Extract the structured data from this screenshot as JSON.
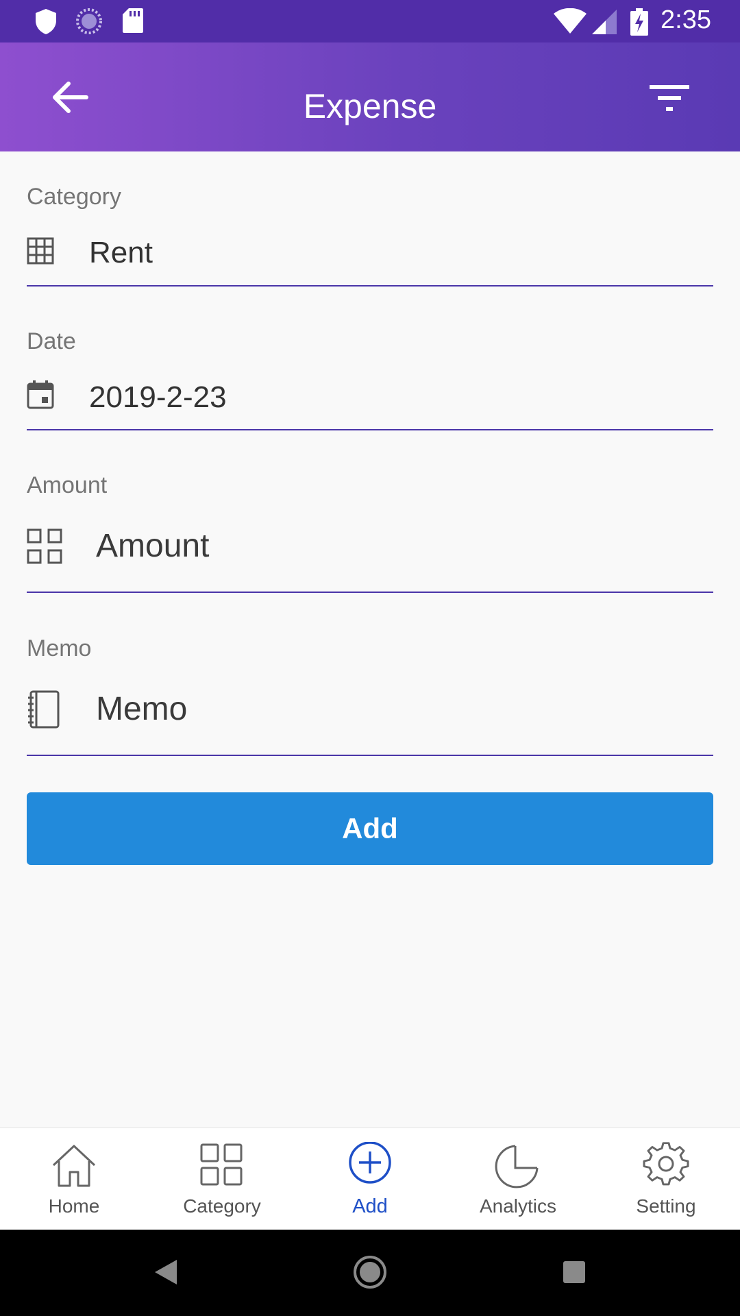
{
  "status_bar": {
    "time": "2:35",
    "left_icons": [
      "shield-icon",
      "sync-icon",
      "sd-card-icon"
    ],
    "right_icons": [
      "wifi-icon",
      "signal-icon",
      "battery-charging-icon"
    ]
  },
  "app_bar": {
    "title": "Expense",
    "back_icon": "arrow-back-icon",
    "filter_icon": "filter-icon"
  },
  "form": {
    "category": {
      "label": "Category",
      "value": "Rent",
      "icon": "grid-table-icon"
    },
    "date": {
      "label": "Date",
      "value": "2019-2-23",
      "icon": "calendar-icon"
    },
    "amount": {
      "label": "Amount",
      "value": "",
      "placeholder": "Amount",
      "icon": "apps-grid-icon"
    },
    "memo": {
      "label": "Memo",
      "value": "",
      "placeholder": "Memo",
      "icon": "notebook-icon"
    },
    "submit_label": "Add"
  },
  "bottom_nav": {
    "items": [
      {
        "label": "Home",
        "icon": "home-icon",
        "active": false
      },
      {
        "label": "Category",
        "icon": "category-grid-icon",
        "active": false
      },
      {
        "label": "Add",
        "icon": "add-circle-icon",
        "active": true
      },
      {
        "label": "Analytics",
        "icon": "pie-chart-icon",
        "active": false
      },
      {
        "label": "Setting",
        "icon": "gear-icon",
        "active": false
      }
    ]
  },
  "colors": {
    "status_bar": "#512da8",
    "app_bar_start": "#8e4fcf",
    "app_bar_end": "#5a3ab4",
    "accent_underline": "#4a35a8",
    "button": "#228adb",
    "nav_active": "#1e4fc7"
  },
  "system_nav": {
    "icons": [
      "back-triangle-icon",
      "home-circle-icon",
      "recents-square-icon"
    ]
  }
}
